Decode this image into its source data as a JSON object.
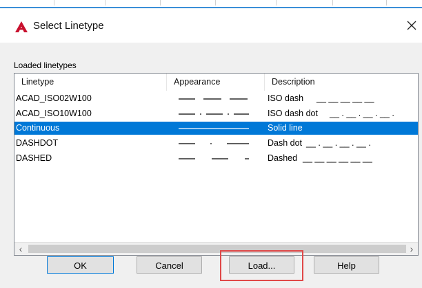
{
  "window": {
    "title": "Select Linetype",
    "app_icon": "autocad-logo-icon",
    "close_icon": "close-icon"
  },
  "group_label": "Loaded linetypes",
  "columns": [
    "Linetype",
    "Appearance",
    "Description"
  ],
  "rows": [
    {
      "name": "ACAD_ISO02W100",
      "description": "ISO dash",
      "pattern": "__ __ __ __ __",
      "appearance": "dash"
    },
    {
      "name": "ACAD_ISO10W100",
      "description": "ISO dash dot",
      "pattern": "__ . __ . __ . __ .",
      "appearance": "dashdot"
    },
    {
      "name": "Continuous",
      "description": "Solid line",
      "pattern": "",
      "appearance": "solid",
      "selected": true
    },
    {
      "name": "DASHDOT",
      "description": "Dash dot",
      "pattern": "__ . __ . __ . __ .",
      "appearance": "dashdot_sparse"
    },
    {
      "name": "DASHED",
      "description": "Dashed",
      "pattern": "__ __ __ __ __ __",
      "appearance": "dashed"
    }
  ],
  "scrollbar": {
    "left_icon": "chevron-left-icon",
    "right_icon": "chevron-right-icon"
  },
  "buttons": {
    "ok": "OK",
    "cancel": "Cancel",
    "load": "Load...",
    "help": "Help"
  },
  "colors": {
    "selection": "#0078d7",
    "highlight_box": "#e04848",
    "app_icon": "#c8102e"
  }
}
